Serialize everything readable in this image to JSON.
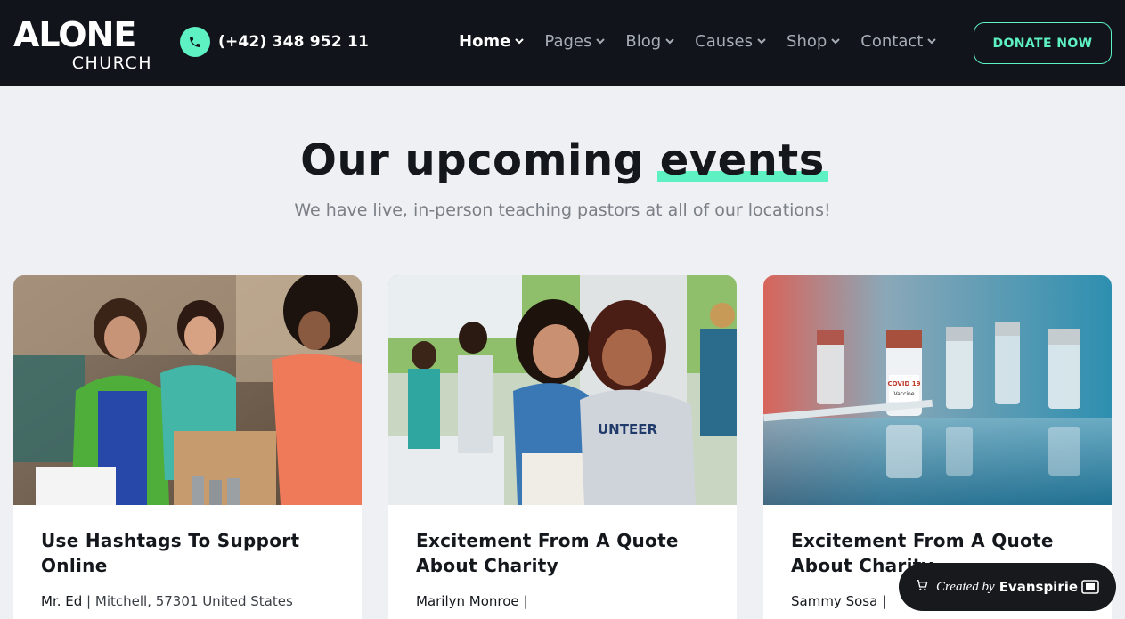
{
  "header": {
    "logo_main": "ALONE",
    "logo_sub": "CHURCH",
    "phone": "(+42) 348 952 11",
    "nav": [
      {
        "label": "Home",
        "active": true
      },
      {
        "label": "Pages",
        "active": false
      },
      {
        "label": "Blog",
        "active": false
      },
      {
        "label": "Causes",
        "active": false
      },
      {
        "label": "Shop",
        "active": false
      },
      {
        "label": "Contact",
        "active": false
      }
    ],
    "donate_label": "DONATE NOW"
  },
  "section": {
    "title_part1": "Our upcoming",
    "title_highlight": "events",
    "subtitle": "We have live, in-person teaching pastors at all of our locations!"
  },
  "events": [
    {
      "title": "Use Hashtags To Support Online",
      "author": "Mr. Ed",
      "location": "Mitchell, 57301 United States",
      "image_icon": "volunteers-food-drive-photo"
    },
    {
      "title": "Excitement From A Quote About Charity",
      "author": "Marilyn Monroe",
      "location": "",
      "image_icon": "mother-daughter-volunteer-photo"
    },
    {
      "title": "Excitement From A Quote About Charity",
      "author": "Sammy Sosa",
      "location": "",
      "image_icon": "vaccine-vials-photo"
    }
  ],
  "badge": {
    "created_by": "Created by",
    "brand": "Evanspirie"
  },
  "colors": {
    "accent": "#5ef1c2",
    "header_bg": "#11151b",
    "page_bg": "#eef0f4"
  }
}
